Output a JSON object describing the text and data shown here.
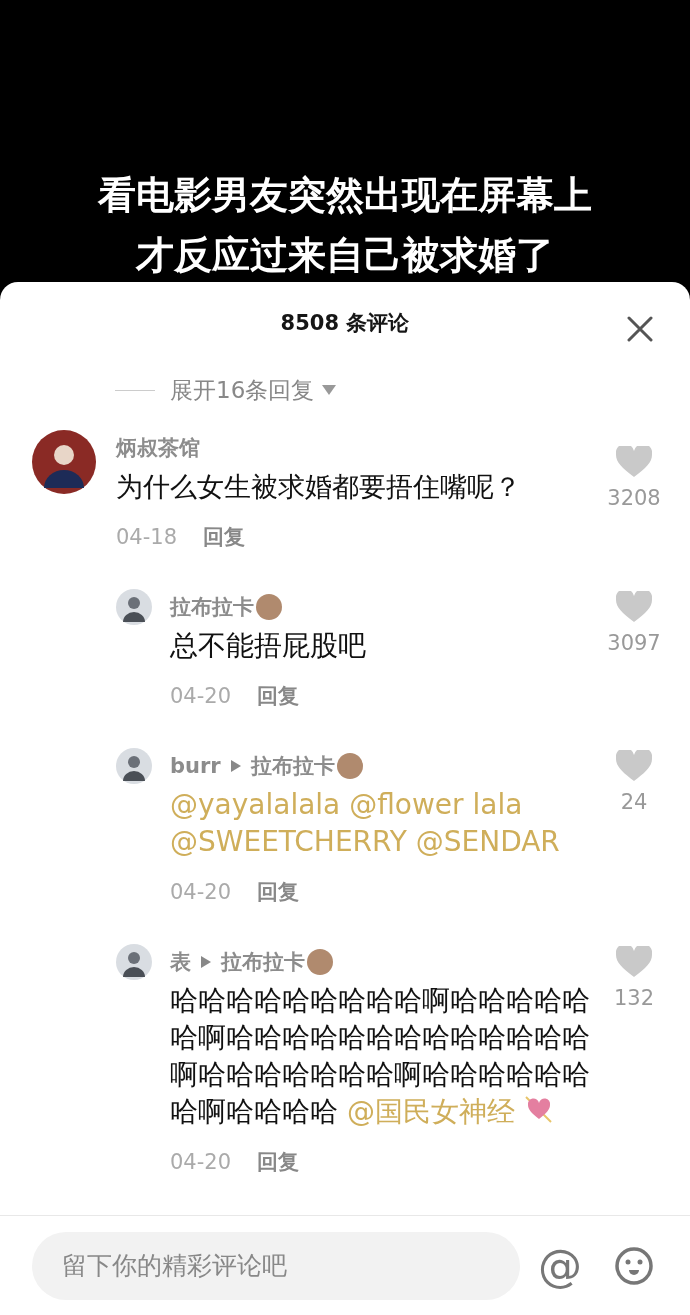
{
  "video": {
    "caption_lines": [
      "看电影男友突然出现在屏幕上",
      "才反应过来自己被求婚了"
    ]
  },
  "sheet": {
    "title": "8508 条评论"
  },
  "expand_replies": "展开16条回复",
  "comments": [
    {
      "author": "炳叔茶馆",
      "author_emoji": false,
      "body": [
        {
          "kind": "text",
          "text": "为什么女生被求婚都要捂住嘴呢？"
        }
      ],
      "trailing_heart": false,
      "date": "04-18",
      "reply_label": "回复",
      "likes": "3208",
      "children": [
        {
          "author": "拉布拉卡",
          "author_emoji": true,
          "body": [
            {
              "kind": "text",
              "text": "总不能捂屁股吧"
            }
          ],
          "trailing_heart": false,
          "date": "04-20",
          "reply_label": "回复",
          "likes": "3097"
        },
        {
          "author": "burr",
          "author_emoji": false,
          "reply_to": "拉布拉卡",
          "reply_to_emoji": true,
          "body": [
            {
              "kind": "mention",
              "text": "@yayalalala"
            },
            {
              "kind": "mention",
              "text": "@flower lala"
            },
            {
              "kind": "mention",
              "text": "@SWEETCHERRY"
            },
            {
              "kind": "mention",
              "text": "@SENDAR"
            }
          ],
          "trailing_heart": false,
          "date": "04-20",
          "reply_label": "回复",
          "likes": "24"
        },
        {
          "author": "表",
          "author_emoji": false,
          "reply_to": "拉布拉卡",
          "reply_to_emoji": true,
          "body": [
            {
              "kind": "text",
              "text": "哈哈哈哈哈哈哈哈哈啊哈哈哈哈哈哈啊哈哈哈哈哈哈哈哈哈哈哈哈哈啊哈哈哈哈哈哈哈啊哈哈哈哈哈哈哈啊哈哈哈哈"
            },
            {
              "kind": "mention",
              "text": "@国民女神经"
            }
          ],
          "trailing_heart": true,
          "date": "04-20",
          "reply_label": "回复",
          "likes": "132"
        }
      ]
    }
  ],
  "composer": {
    "placeholder": "留下你的精彩评论吧",
    "mention_button": "@"
  }
}
